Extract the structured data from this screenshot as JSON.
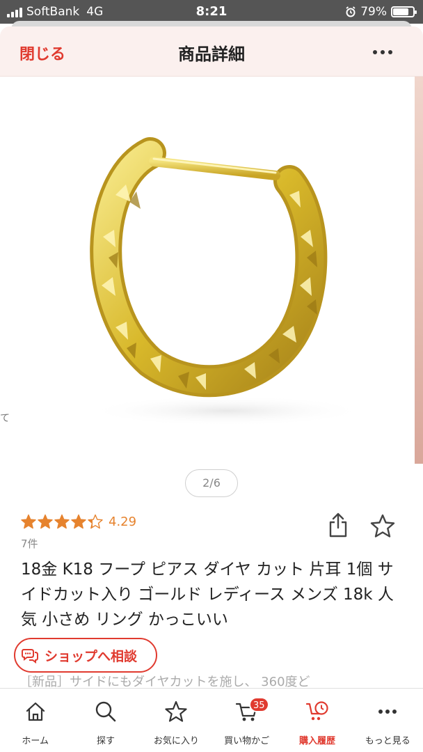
{
  "status_bar": {
    "carrier": "SoftBank",
    "network": "4G",
    "time": "8:21",
    "battery_percent": "79%",
    "battery_level": 0.79
  },
  "header": {
    "close_label": "閉じる",
    "title": "商品詳細",
    "more_icon": "more-horizontal-icon"
  },
  "gallery": {
    "counter": "2/6",
    "prev_edge_text": "て"
  },
  "rating": {
    "value": "4.29",
    "stars": 4.29,
    "review_count": "7件"
  },
  "product": {
    "name": "18金 K18 フープ ピアス ダイヤ カット 片耳 1個  サイドカット入り ゴールド レディース メンズ 18k 人気 小さめ リング かっこいい"
  },
  "shop_button": {
    "label": "ショップへ相談"
  },
  "description_preview": "［新品］サイドにもダイヤカットを施し、 360度ど",
  "tabs": [
    {
      "label": "ホーム",
      "icon": "home-icon"
    },
    {
      "label": "探す",
      "icon": "search-icon"
    },
    {
      "label": "お気に入り",
      "icon": "star-icon"
    },
    {
      "label": "買い物かご",
      "icon": "cart-icon",
      "badge": "35"
    },
    {
      "label": "購入履歴",
      "icon": "history-icon",
      "active": true
    },
    {
      "label": "もっと見る",
      "icon": "more-icon"
    }
  ],
  "colors": {
    "accent": "#e03a2f",
    "star": "#e6832e",
    "header_bg": "#fbf0ee",
    "gold": "#d8b82a"
  }
}
